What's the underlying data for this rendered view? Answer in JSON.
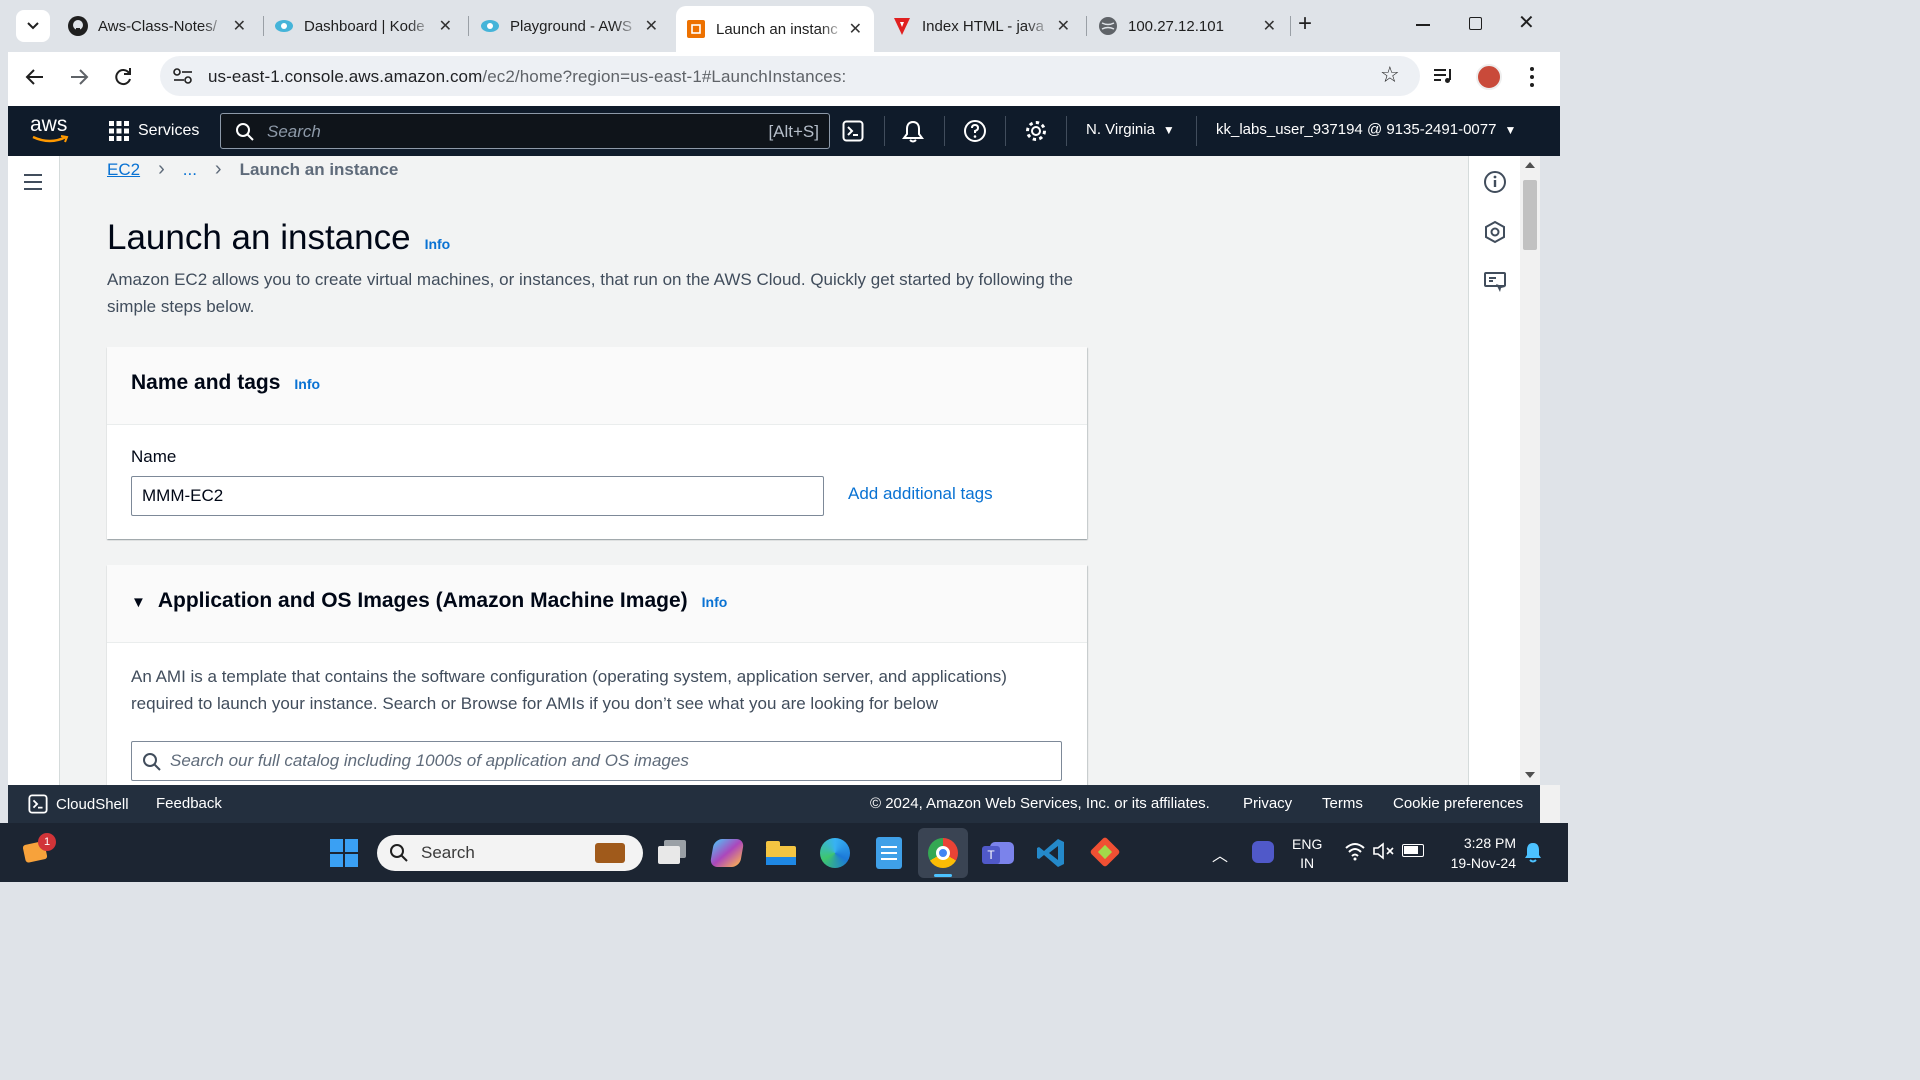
{
  "browser": {
    "tabs": [
      {
        "title": "Aws-Class-Notes/"
      },
      {
        "title": "Dashboard | Kode"
      },
      {
        "title": "Playground - AWS"
      },
      {
        "title": "Launch an instanc"
      },
      {
        "title": "Index HTML - java"
      },
      {
        "title": "100.27.12.101"
      }
    ],
    "url_host": "us-east-1.console.aws.amazon.com",
    "url_path": "/ec2/home?region=us-east-1#LaunchInstances:"
  },
  "aws_header": {
    "logo": "aws",
    "services": "Services",
    "search_placeholder": "Search",
    "search_shortcut": "[Alt+S]",
    "region": "N. Virginia",
    "account": "kk_labs_user_937194 @ 9135-2491-0077"
  },
  "breadcrumb": {
    "root": "EC2",
    "ellipsis": "...",
    "current": "Launch an instance"
  },
  "page": {
    "title": "Launch an instance",
    "info": "Info",
    "description": "Amazon EC2 allows you to create virtual machines, or instances, that run on the AWS Cloud. Quickly get started by following the simple steps below."
  },
  "name_tags": {
    "title": "Name and tags",
    "info": "Info",
    "name_label": "Name",
    "name_value": "MMM-EC2",
    "add_tags": "Add additional tags"
  },
  "ami": {
    "title": "Application and OS Images (Amazon Machine Image)",
    "info": "Info",
    "description": "An AMI is a template that contains the software configuration (operating system, application server, and applications) required to launch your instance. Search or Browse for AMIs if you don’t see what you are looking for below",
    "search_placeholder": "Search our full catalog including 1000s of application and OS images"
  },
  "footer": {
    "cloudshell": "CloudShell",
    "feedback": "Feedback",
    "copyright": "© 2024, Amazon Web Services, Inc. or its affiliates.",
    "privacy": "Privacy",
    "terms": "Terms",
    "cookies": "Cookie preferences"
  },
  "taskbar": {
    "search": "Search",
    "notification_count": "1",
    "lang_top": "ENG",
    "lang_bottom": "IN",
    "time": "3:28 PM",
    "date": "19-Nov-24"
  },
  "colors": {
    "aws_header_bg": "#0f1b2a",
    "aws_link": "#0972d3",
    "aws_orange": "#ff9900",
    "footer_bg": "#232f3e"
  }
}
